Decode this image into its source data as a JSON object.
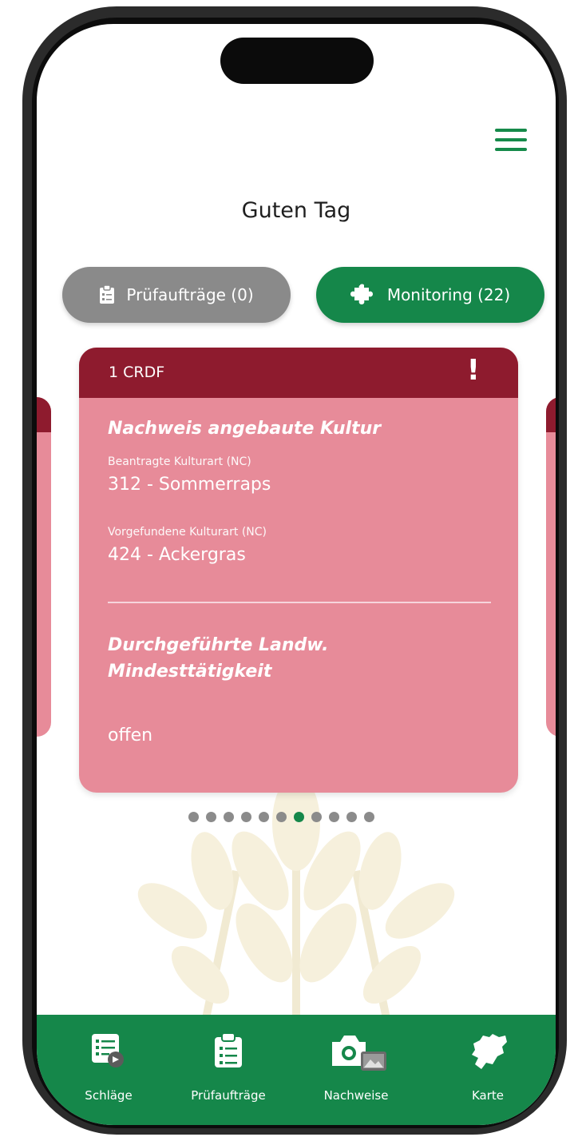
{
  "header": {
    "greeting": "Guten Tag"
  },
  "filters": {
    "pruefauftraege": "Prüfaufträge (0)",
    "monitoring": "Monitoring (22)"
  },
  "card": {
    "code": "1 CRDF",
    "alert_symbol": "!",
    "section1_title": "Nachweis angebaute Kultur",
    "requested_label": "Beantragte Kulturart (NC)",
    "requested_value": "312 - Sommerraps",
    "found_label": "Vorgefundene Kulturart (NC)",
    "found_value": "424 - Ackergras",
    "section2_title_line1": "Durchgeführte Landw.",
    "section2_title_line2": "Mindesttätigkeit",
    "status": "offen"
  },
  "pagination": {
    "total": 11,
    "active_index": 6
  },
  "nav": {
    "items": [
      {
        "label": "Schläge",
        "icon": "field-list-icon"
      },
      {
        "label": "Prüfaufträge",
        "icon": "clipboard-icon"
      },
      {
        "label": "Nachweise",
        "icon": "camera-icon"
      },
      {
        "label": "Karte",
        "icon": "map-icon"
      }
    ]
  },
  "colors": {
    "brand_green": "#15874a",
    "card_red": "#8e1b2e",
    "card_pink": "#e78b99",
    "pill_grey": "#8a8a8a"
  }
}
